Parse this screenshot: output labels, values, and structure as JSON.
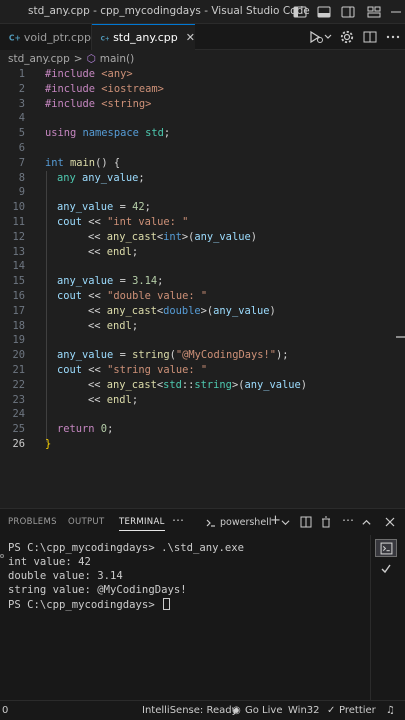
{
  "window": {
    "title": "std_any.cpp - cpp_mycodingdays - Visual Studio Code"
  },
  "tabs": [
    {
      "label": "void_ptr.cpp",
      "active": false
    },
    {
      "label": "std_any.cpp",
      "active": true
    }
  ],
  "breadcrumb": {
    "file": "std_any.cpp",
    "separator": ">",
    "symbol": "main()"
  },
  "editor": {
    "line_numbers": [
      "1",
      "2",
      "3",
      "4",
      "5",
      "6",
      "7",
      "8",
      "9",
      "10",
      "11",
      "12",
      "13",
      "14",
      "15",
      "16",
      "17",
      "18",
      "19",
      "20",
      "21",
      "22",
      "23",
      "24",
      "25",
      "26"
    ],
    "active_line": "26",
    "code": {
      "l1": [
        "#include",
        " <any>"
      ],
      "l2": [
        "#include",
        " <iostream>"
      ],
      "l3": [
        "#include",
        " <string>"
      ],
      "l5": [
        "using",
        " namespace",
        " std",
        ";"
      ],
      "l7": [
        "int",
        " main",
        "()",
        " {"
      ],
      "l8": [
        "any",
        " any_value",
        ";"
      ],
      "l10": [
        "any_value",
        " = ",
        "42",
        ";"
      ],
      "l11": [
        "cout",
        " << ",
        "\"int value: \""
      ],
      "l12": [
        "<< ",
        "any_cast",
        "<",
        "int",
        ">",
        "(",
        "any_value",
        ")"
      ],
      "l13": [
        "<< ",
        "endl",
        ";"
      ],
      "l15": [
        "any_value",
        " = ",
        "3.14",
        ";"
      ],
      "l16": [
        "cout",
        " << ",
        "\"double value: \""
      ],
      "l17": [
        "<< ",
        "any_cast",
        "<",
        "double",
        ">",
        "(",
        "any_value",
        ")"
      ],
      "l18": [
        "<< ",
        "endl",
        ";"
      ],
      "l20": [
        "any_value",
        " = ",
        "string",
        "(",
        "\"@MyCodingDays!\"",
        ");"
      ],
      "l21": [
        "cout",
        " << ",
        "\"string value: \""
      ],
      "l22": [
        "<< ",
        "any_cast",
        "<",
        "std",
        "::",
        "string",
        ">",
        "(",
        "any_value",
        ")"
      ],
      "l23": [
        "<< ",
        "endl",
        ";"
      ],
      "l25": [
        "return",
        " 0",
        ";"
      ],
      "l26": [
        "}"
      ]
    }
  },
  "panel": {
    "tabs": [
      "PROBLEMS",
      "OUTPUT",
      "TERMINAL"
    ],
    "active_tab": "TERMINAL",
    "shell": "powershell",
    "terminal_lines": [
      "PS C:\\cpp_mycodingdays> .\\std_any.exe",
      "int value: 42",
      "double value: 3.14",
      "string value: @MyCodingDays!",
      "PS C:\\cpp_mycodingdays> "
    ]
  },
  "statusbar": {
    "errors": "0",
    "intellisense": "IntelliSense: Ready",
    "golive": "Go Live",
    "platform": "Win32",
    "prettier": "Prettier"
  },
  "colors": {
    "keyword": "#569cd6",
    "preprocessor": "#c586c0",
    "string": "#ce9178",
    "number": "#b5cea8",
    "type": "#4ec9b0",
    "function": "#dcdcaa",
    "variable": "#9cdcfe",
    "accent": "#0078d4"
  }
}
